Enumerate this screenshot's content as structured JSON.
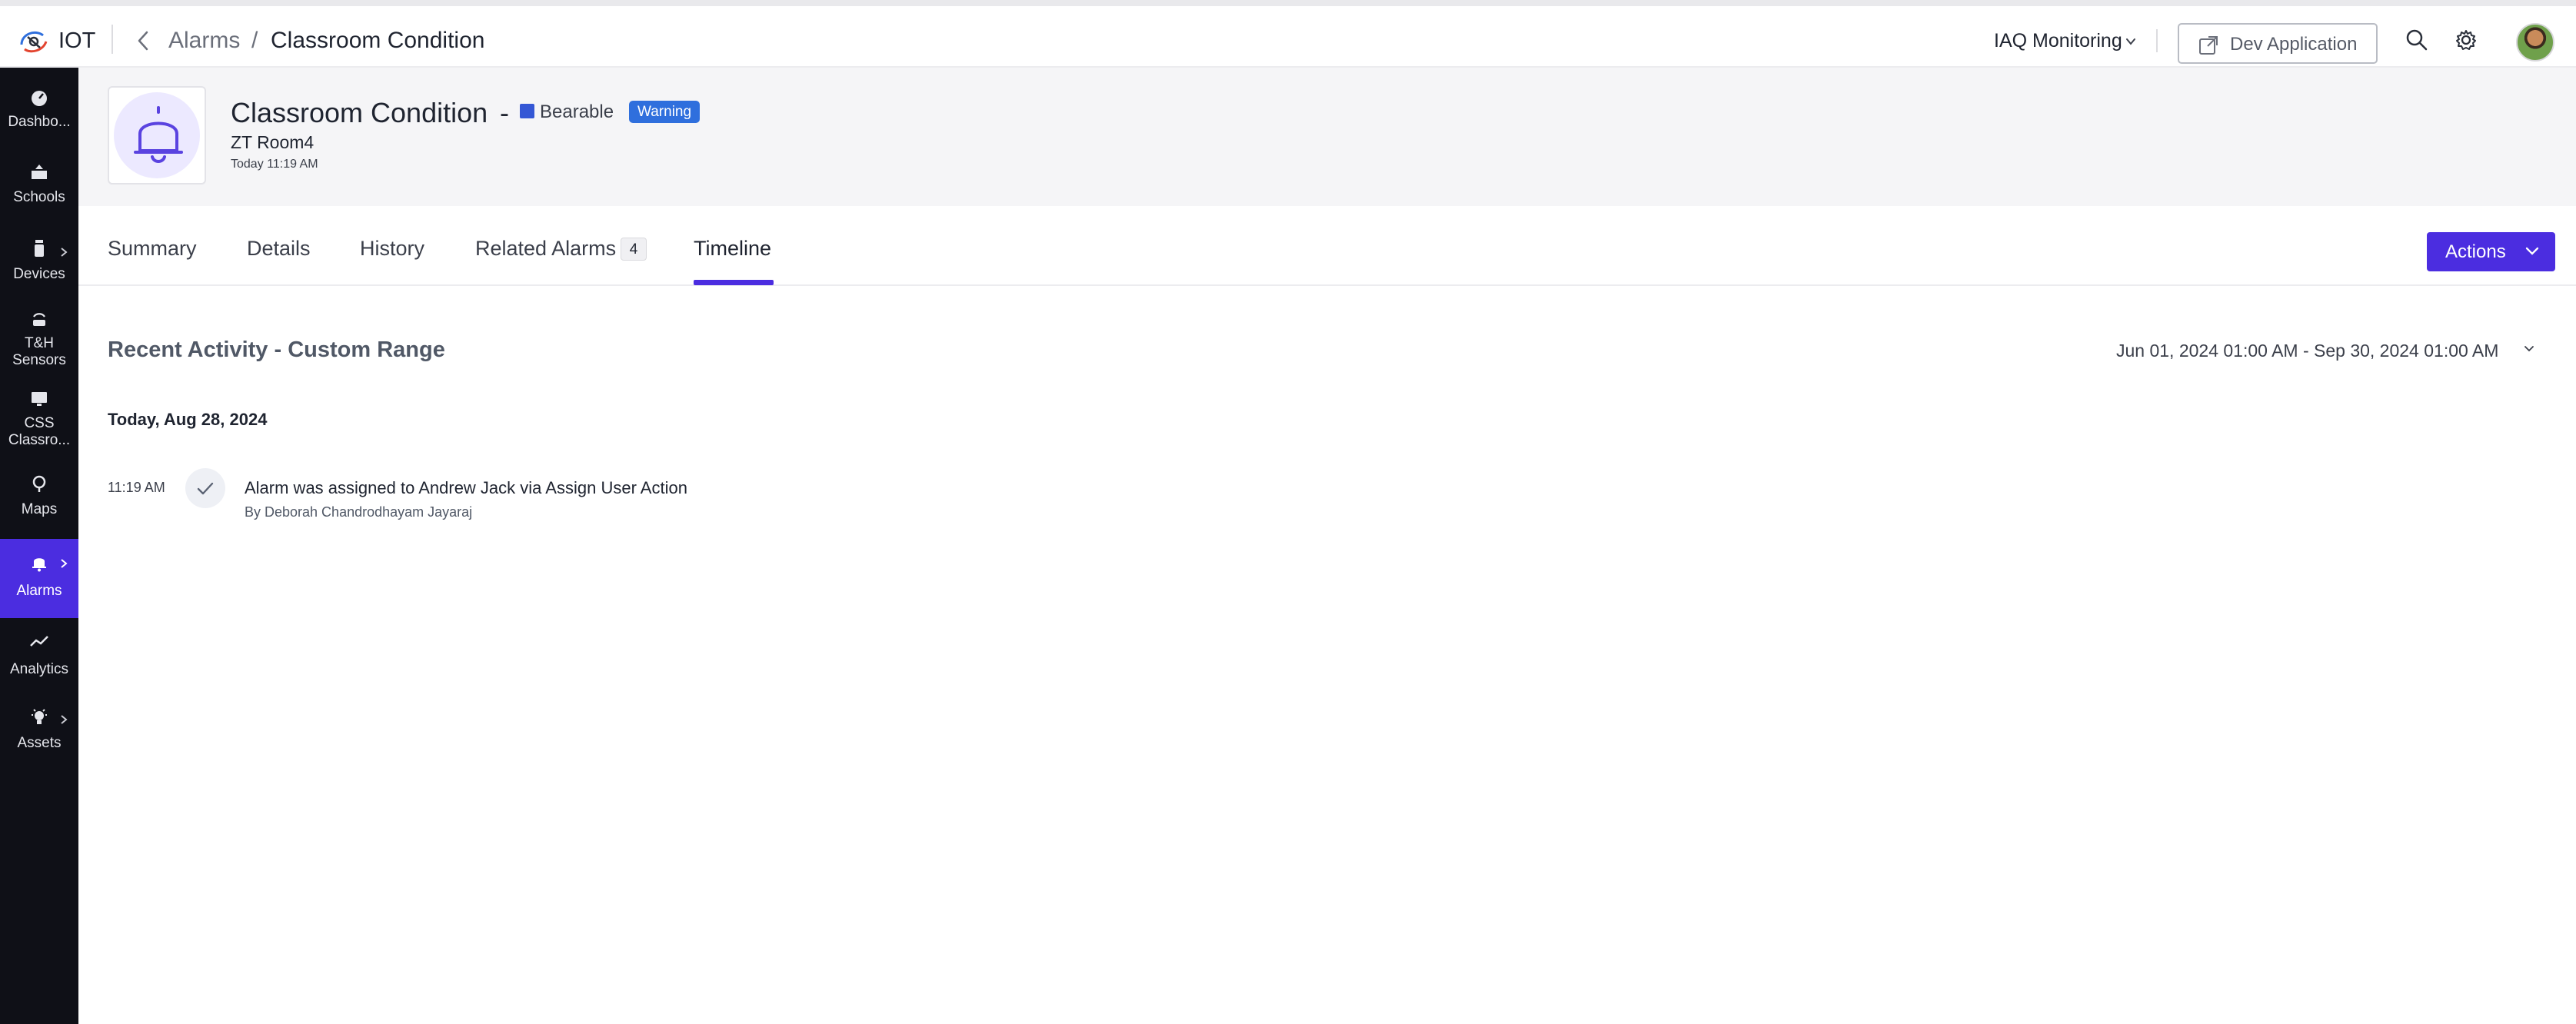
{
  "app": {
    "name": "IOT"
  },
  "breadcrumb": {
    "parent": "Alarms",
    "separator": "/",
    "current": "Classroom Condition"
  },
  "topbar": {
    "workspace": "IAQ Monitoring",
    "dev_button": "Dev Application",
    "icons": [
      "search-icon",
      "gear-icon"
    ]
  },
  "sidebar": {
    "items": [
      {
        "label1": "Dashbo...",
        "label2": "",
        "icon": "dashboard-icon",
        "chevron": false,
        "active": false
      },
      {
        "label1": "Schools",
        "label2": "",
        "icon": "buildings-icon",
        "chevron": false,
        "active": false
      },
      {
        "label1": "Devices",
        "label2": "",
        "icon": "device-icon",
        "chevron": true,
        "active": false
      },
      {
        "label1": "T&H",
        "label2": "Sensors",
        "icon": "sensor-icon",
        "chevron": false,
        "active": false
      },
      {
        "label1": "CSS",
        "label2": "Classro...",
        "icon": "monitor-icon",
        "chevron": false,
        "active": false
      },
      {
        "label1": "Maps",
        "label2": "",
        "icon": "map-pin-icon",
        "chevron": false,
        "active": false
      },
      {
        "label1": "Alarms",
        "label2": "",
        "icon": "bell-icon",
        "chevron": true,
        "active": true
      },
      {
        "label1": "Analytics",
        "label2": "",
        "icon": "analytics-icon",
        "chevron": false,
        "active": false
      },
      {
        "label1": "Assets",
        "label2": "",
        "icon": "bulb-icon",
        "chevron": true,
        "active": false
      }
    ]
  },
  "alarm": {
    "title": "Classroom Condition",
    "dash": "-",
    "severity_label": "Bearable",
    "severity_color": "#3457d5",
    "status_badge": "Warning",
    "room": "ZT Room4",
    "time": "Today 11:19 AM"
  },
  "tabs": {
    "summary": "Summary",
    "details": "Details",
    "history": "History",
    "related": "Related Alarms",
    "related_count": "4",
    "timeline": "Timeline",
    "active": "Timeline"
  },
  "actions_label": "Actions",
  "timeline": {
    "heading": "Recent Activity - Custom Range",
    "range": "Jun 01, 2024 01:00 AM - Sep 30, 2024 01:00 AM",
    "date": "Today, Aug 28, 2024",
    "events": [
      {
        "time": "11:19 AM",
        "text": "Alarm was assigned to Andrew Jack via Assign User Action",
        "by": "By Deborah Chandrodhayam Jayaraj",
        "icon": "check-icon"
      }
    ]
  },
  "colors": {
    "accent": "#4b2de0",
    "sidebar_bg": "#0f1017",
    "badge": "#2f6fdd"
  }
}
